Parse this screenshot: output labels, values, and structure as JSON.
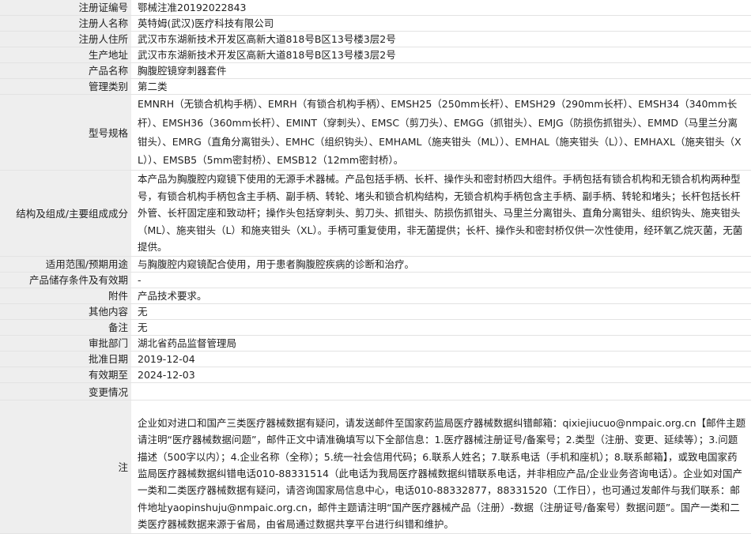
{
  "rows": [
    {
      "label": "注册证编号",
      "value": "鄂械注准20192022843"
    },
    {
      "label": "注册人名称",
      "value": "英特姆(武汉)医疗科技有限公司"
    },
    {
      "label": "注册人住所",
      "value": "武汉市东湖新技术开发区高新大道818号B区13号楼3层2号"
    },
    {
      "label": "生产地址",
      "value": "武汉市东湖新技术开发区高新大道818号B区13号楼3层2号"
    },
    {
      "label": "产品名称",
      "value": "胸腹腔镜穿刺器套件"
    },
    {
      "label": "管理类别",
      "value": "第二类"
    },
    {
      "label": "型号规格",
      "value": "EMNRH（无锁合机构手柄）、EMRH（有锁合机构手柄）、EMSH25（250mm长杆）、EMSH29（290mm长杆）、EMSH34（340mm长杆）、EMSH36（360mm长杆）、EMINT（穿刺头）、EMSC（剪刀头）、EMGG（抓钳头）、EMJG（防损伤抓钳头）、EMMD（马里兰分离钳头）、EMRG（直角分离钳头）、EMHC（组织钩头）、EMHAML（施夹钳头（ML））、EMHAL（施夹钳头（L））、EMHAXL（施夹钳头（XL））、EMSB5（5mm密封桥）、EMSB12（12mm密封桥）。"
    },
    {
      "label": "结构及组成/主要组成成分",
      "value": "本产品为胸腹腔内窥镜下使用的无源手术器械。产品包括手柄、长杆、操作头和密封桥四大组件。手柄包括有锁合机构和无锁合机构两种型号，有锁合机构手柄包含主手柄、副手柄、转轮、堵头和锁合机构结构，无锁合机构手柄包含主手柄、副手柄、转轮和堵头；长杆包括长杆外管、长杆固定座和致动杆；操作头包括穿刺头、剪刀头、抓钳头、防损伤抓钳头、马里兰分离钳头、直角分离钳头、组织钩头、施夹钳头（ML）、施夹钳头（L）和施夹钳头（XL）。手柄可重复使用，非无菌提供；长杆、操作头和密封桥仅供一次性使用，经环氧乙烷灭菌，无菌提供。"
    },
    {
      "label": "适用范围/预期用途",
      "value": "与胸腹腔内窥镜配合使用，用于患者胸腹腔疾病的诊断和治疗。"
    },
    {
      "label": "产品储存条件及有效期",
      "value": "-"
    },
    {
      "label": "附件",
      "value": "产品技术要求。"
    },
    {
      "label": "其他内容",
      "value": "无"
    },
    {
      "label": "备注",
      "value": "无"
    },
    {
      "label": "审批部门",
      "value": "湖北省药品监督管理局"
    },
    {
      "label": "批准日期",
      "value": "2019-12-04"
    },
    {
      "label": "有效期至",
      "value": "2024-12-03"
    },
    {
      "label": "变更情况",
      "value": ""
    },
    {
      "label": "注",
      "value": "企业如对进口和国产三类医疗器械数据有疑问，请发送邮件至国家药监局医疗器械数据纠错邮箱：qixiejiucuo@nmpaic.org.cn【邮件主题请注明“医疗器械数据问题”，邮件正文中请准确填写以下全部信息：1.医疗器械注册证号/备案号；2.类型（注册、变更、延续等）；3.问题描述（500字以内）；4.企业名称（全称）；5.统一社会信用代码；6.联系人姓名；7.联系电话（手机和座机）；8.联系邮箱】，或致电国家药监局医疗器械数据纠错电话010-88331514（此电话为我局医疗器械数据纠错联系电话，并非相应产品/企业业务咨询电话）。企业如对国产一类和二类医疗器械数据有疑问，请咨询国家局信息中心，电话010-88332877，88331520（工作日），也可通过发邮件与我们联系：邮件地址yaopinshuju@nmpaic.org.cn，邮件主题请注明“国产医疗器械产品（注册）-数据（注册证号/备案号）数据问题”。国产一类和二类医疗器械数据来源于省局，由省局通过数据共享平台进行纠错和维护。"
    }
  ]
}
